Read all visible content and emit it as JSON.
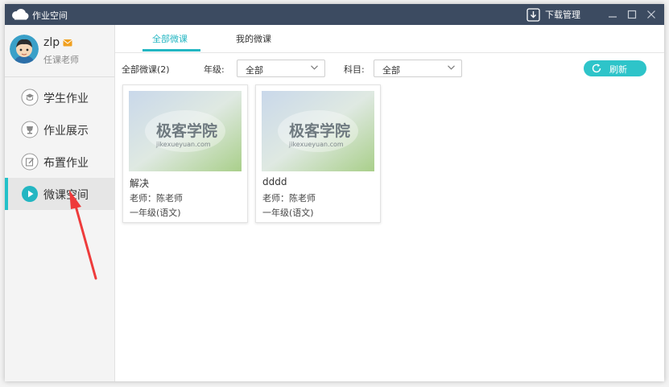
{
  "window": {
    "app_title": "作业空间",
    "download_label": "下载管理"
  },
  "profile": {
    "username": "zlp",
    "role": "任课老师"
  },
  "sidebar": {
    "items": [
      {
        "label": "学生作业",
        "icon": "student-homework-icon"
      },
      {
        "label": "作业展示",
        "icon": "homework-display-icon"
      },
      {
        "label": "布置作业",
        "icon": "assign-homework-icon"
      },
      {
        "label": "微课空间",
        "icon": "play-icon",
        "active": true
      }
    ]
  },
  "tabs": [
    {
      "label": "全部微课",
      "active": true
    },
    {
      "label": "我的微课",
      "active": false
    }
  ],
  "filters": {
    "count_label": "全部微课(2)",
    "grade_label": "年级:",
    "grade_value": "全部",
    "subject_label": "科目:",
    "subject_value": "全部",
    "refresh_label": "刷新"
  },
  "cards": [
    {
      "title": "解决",
      "teacher": "老师：陈老师",
      "grade": "一年级(语文)",
      "thumb_text": "极客学院",
      "thumb_sub": "jikexueyuan.com"
    },
    {
      "title": "dddd",
      "teacher": "老师：陈老师",
      "grade": "一年级(语文)",
      "thumb_text": "极客学院",
      "thumb_sub": "jikexueyuan.com"
    }
  ],
  "colors": {
    "titlebar": "#3c4b61",
    "accent": "#23b6c2",
    "annotation_arrow": "#ee3b3b"
  }
}
